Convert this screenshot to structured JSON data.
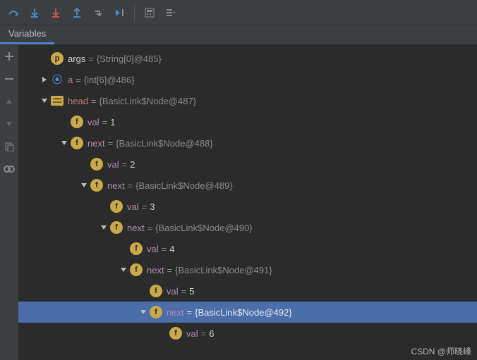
{
  "toolbar": {
    "icons": [
      "step-over",
      "step-into",
      "force-step-into",
      "step-out",
      "drop-frame",
      "run-to-cursor",
      "evaluate",
      "trace"
    ]
  },
  "tabs": {
    "active": "Variables"
  },
  "gutter": {
    "icons": [
      "add",
      "remove",
      "up",
      "down",
      "copy",
      "watch"
    ]
  },
  "rows": [
    {
      "indent": 0,
      "arrow": "",
      "badge": "p",
      "bclass": "b-p",
      "nclass": "name-args",
      "name": "args",
      "valclass": "gval",
      "value": "{String[0]@485}"
    },
    {
      "indent": 0,
      "arrow": "right",
      "badge": "arr",
      "bclass": "b-arr",
      "nclass": "name-red",
      "name": "a",
      "valclass": "gval",
      "value": "{int[6]@486}"
    },
    {
      "indent": 0,
      "arrow": "down",
      "badge": "obj",
      "bclass": "b-obj",
      "nclass": "name-red",
      "name": "head",
      "valclass": "gval",
      "value": "{BasicLink$Node@487}"
    },
    {
      "indent": 1,
      "arrow": "",
      "badge": "f",
      "bclass": "b-f",
      "nclass": "name-purple",
      "name": "val",
      "valclass": "wval",
      "value": "1"
    },
    {
      "indent": 1,
      "arrow": "down",
      "badge": "f",
      "bclass": "b-f",
      "nclass": "name-purple",
      "name": "next",
      "valclass": "gval",
      "value": "{BasicLink$Node@488}"
    },
    {
      "indent": 2,
      "arrow": "",
      "badge": "f",
      "bclass": "b-f",
      "nclass": "name-purple",
      "name": "val",
      "valclass": "wval",
      "value": "2"
    },
    {
      "indent": 2,
      "arrow": "down",
      "badge": "f",
      "bclass": "b-f",
      "nclass": "name-purple",
      "name": "next",
      "valclass": "gval",
      "value": "{BasicLink$Node@489}"
    },
    {
      "indent": 3,
      "arrow": "",
      "badge": "f",
      "bclass": "b-f",
      "nclass": "name-purple",
      "name": "val",
      "valclass": "wval",
      "value": "3"
    },
    {
      "indent": 3,
      "arrow": "down",
      "badge": "f",
      "bclass": "b-f",
      "nclass": "name-purple",
      "name": "next",
      "valclass": "gval",
      "value": "{BasicLink$Node@490}"
    },
    {
      "indent": 4,
      "arrow": "",
      "badge": "f",
      "bclass": "b-f",
      "nclass": "name-purple",
      "name": "val",
      "valclass": "wval",
      "value": "4"
    },
    {
      "indent": 4,
      "arrow": "down",
      "badge": "f",
      "bclass": "b-f",
      "nclass": "name-purple",
      "name": "next",
      "valclass": "gval",
      "value": "{BasicLink$Node@491}"
    },
    {
      "indent": 5,
      "arrow": "",
      "badge": "f",
      "bclass": "b-f",
      "nclass": "name-purple",
      "name": "val",
      "valclass": "wval",
      "value": "5"
    },
    {
      "indent": 5,
      "arrow": "down",
      "badge": "f",
      "bclass": "b-f",
      "nclass": "name-purple",
      "name": "next",
      "valclass": "gval",
      "value": "{BasicLink$Node@492}",
      "selected": true
    },
    {
      "indent": 6,
      "arrow": "",
      "badge": "f",
      "bclass": "b-f",
      "nclass": "name-purple",
      "name": "val",
      "valclass": "wval",
      "value": "6"
    }
  ],
  "watermark": "CSDN @师晓峰"
}
